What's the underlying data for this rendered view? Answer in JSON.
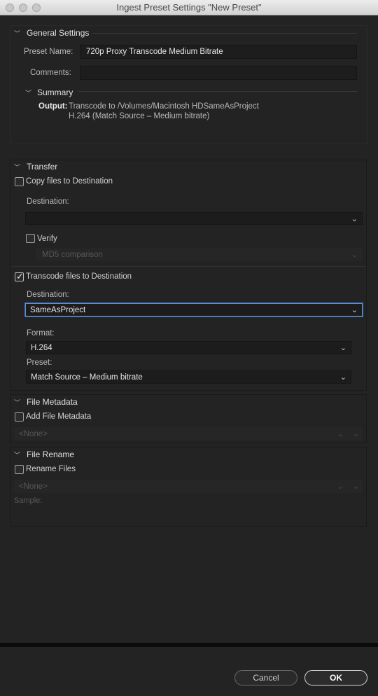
{
  "window": {
    "title": "Ingest Preset Settings \"New Preset\""
  },
  "general": {
    "title": "General Settings",
    "preset_name_label": "Preset Name:",
    "preset_name_value": "720p Proxy Transcode Medium Bitrate",
    "comments_label": "Comments:",
    "comments_value": "",
    "summary_title": "Summary",
    "output_label": "Output:",
    "output_line1": "Transcode to /Volumes/Macintosh HDSameAsProject",
    "output_line2": "H.264 (Match Source – Medium bitrate)"
  },
  "transfer": {
    "title": "Transfer",
    "copy_label": "Copy files to Destination",
    "copy_checked": false,
    "copy_destination_label": "Destination:",
    "copy_destination_value": "",
    "verify_label": "Verify",
    "verify_checked": false,
    "verify_method": "MD5 comparison",
    "transcode_label": "Transcode files to Destination",
    "transcode_checked": true,
    "transcode_destination_label": "Destination:",
    "transcode_destination_value": "SameAsProject",
    "format_label": "Format:",
    "format_value": "H.264",
    "preset_label": "Preset:",
    "preset_value": "Match Source – Medium bitrate"
  },
  "metadata": {
    "title": "File Metadata",
    "add_label": "Add File Metadata",
    "add_checked": false,
    "select_value": "<None>"
  },
  "rename": {
    "title": "File Rename",
    "rename_label": "Rename Files",
    "rename_checked": false,
    "select_value": "<None>",
    "sample_label": "Sample:"
  },
  "buttons": {
    "cancel": "Cancel",
    "ok": "OK"
  },
  "icons": {
    "chevron": "chevron-down-icon",
    "disclosure": "disclosure-triangle-icon",
    "check": "checkmark-icon"
  },
  "colors": {
    "focus_ring": "#5b8fd6",
    "background": "#232323"
  }
}
